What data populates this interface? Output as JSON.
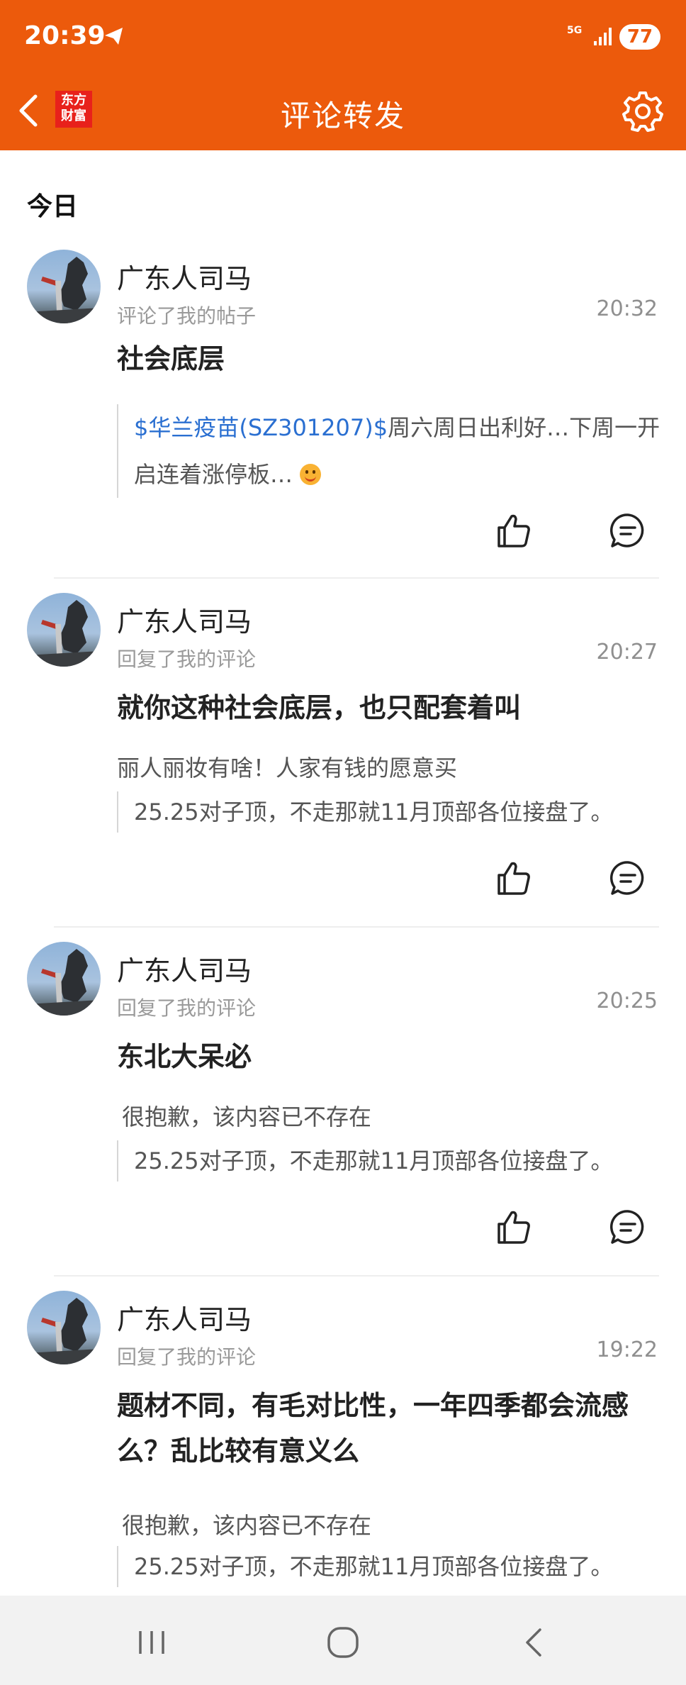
{
  "status_bar": {
    "time": "20:39",
    "network": "5G",
    "battery": "77"
  },
  "app_bar": {
    "logo_line1": "东方",
    "logo_line2": "财富",
    "title": "评论转发"
  },
  "section_title": "今日",
  "items": [
    {
      "username": "广东人司马",
      "action": "评论了我的帖子",
      "time": "20:32",
      "comment": "社会底层",
      "quote_stock": "$华兰疫苗(SZ301207)$",
      "quote_text": "周六周日出利好…下周一开启连着涨停板…"
    },
    {
      "username": "广东人司马",
      "action": "回复了我的评论",
      "time": "20:27",
      "comment": "就你这种社会底层，也只配套着叫",
      "reply_to": "丽人丽妆有啥！人家有钱的愿意买",
      "quote_text": "25.25对子顶，不走那就11月顶部各位接盘了。"
    },
    {
      "username": "广东人司马",
      "action": "回复了我的评论",
      "time": "20:25",
      "comment": "东北大呆必",
      "reply_to": "很抱歉，该内容已不存在",
      "quote_text": "25.25对子顶，不走那就11月顶部各位接盘了。"
    },
    {
      "username": "广东人司马",
      "action": "回复了我的评论",
      "time": "19:22",
      "comment": "题材不同，有毛对比性，一年四季都会流感么？乱比较有意义么",
      "reply_to": "很抱歉，该内容已不存在",
      "quote_text": "25.25对子顶，不走那就11月顶部各位接盘了。"
    }
  ],
  "colors": {
    "brand": "#ec5a0c",
    "stock_link": "#2a6fd1"
  }
}
